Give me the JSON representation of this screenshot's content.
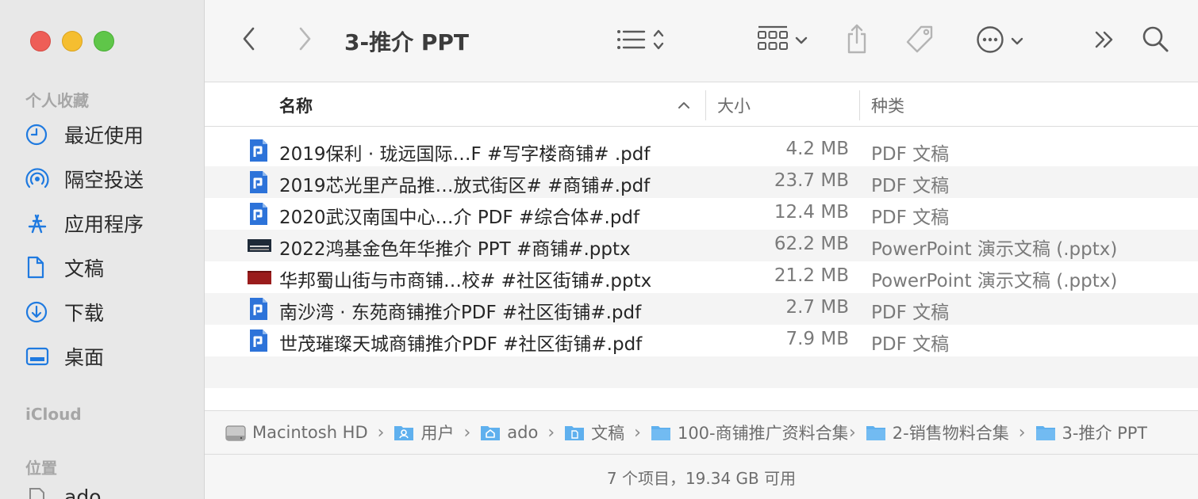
{
  "window": {
    "title": "3-推介 PPT"
  },
  "sidebar": {
    "favorites_label": "个人收藏",
    "items": [
      {
        "label": "最近使用",
        "icon": "clock-icon"
      },
      {
        "label": "隔空投送",
        "icon": "airdrop-icon"
      },
      {
        "label": "应用程序",
        "icon": "applications-icon"
      },
      {
        "label": "文稿",
        "icon": "document-icon"
      },
      {
        "label": "下载",
        "icon": "download-icon"
      },
      {
        "label": "桌面",
        "icon": "desktop-icon"
      }
    ],
    "icloud_label": "iCloud",
    "locations_label": "位置",
    "partial_item_label": "ado"
  },
  "columns": {
    "name": "名称",
    "size": "大小",
    "kind": "种类"
  },
  "files": [
    {
      "name": "2019保利 · 珑远国际…F #写字楼商铺# .pdf",
      "size": "4.2 MB",
      "kind": "PDF 文稿",
      "icon": "pdf-file-icon"
    },
    {
      "name": "2019芯光里产品推…放式街区# #商铺#.pdf",
      "size": "23.7 MB",
      "kind": "PDF 文稿",
      "icon": "pdf-file-icon"
    },
    {
      "name": "2020武汉南国中心…介 PDF #综合体#.pdf",
      "size": "12.4 MB",
      "kind": "PDF 文稿",
      "icon": "pdf-file-icon"
    },
    {
      "name": "2022鸿基金色年华推介 PPT #商铺#.pptx",
      "size": "62.2 MB",
      "kind": "PowerPoint 演示文稿 (.pptx)",
      "icon": "pptx-thumbnail-dark-icon"
    },
    {
      "name": "华邦蜀山街与市商铺…校# #社区街铺#.pptx",
      "size": "21.2 MB",
      "kind": "PowerPoint 演示文稿 (.pptx)",
      "icon": "pptx-thumbnail-red-icon"
    },
    {
      "name": "南沙湾 · 东苑商铺推介PDF #社区街铺#.pdf",
      "size": "2.7 MB",
      "kind": "PDF 文稿",
      "icon": "pdf-file-icon"
    },
    {
      "name": "世茂璀璨天城商铺推介PDF #社区街铺#.pdf",
      "size": "7.9 MB",
      "kind": "PDF 文稿",
      "icon": "pdf-file-icon"
    }
  ],
  "path": [
    {
      "label": "Macintosh HD",
      "icon": "hard-drive-icon"
    },
    {
      "label": "用户",
      "icon": "users-folder-icon"
    },
    {
      "label": "ado",
      "icon": "home-folder-icon"
    },
    {
      "label": "文稿",
      "icon": "documents-folder-icon"
    },
    {
      "label": "100-商铺推广资料合集",
      "icon": "folder-icon"
    },
    {
      "label": "2-销售物料合集",
      "icon": "folder-icon"
    },
    {
      "label": "3-推介 PPT",
      "icon": "folder-icon"
    }
  ],
  "status": {
    "text": "7 个项目，19.34 GB 可用"
  },
  "colors": {
    "accent": "#1f7ae0",
    "folder": "#4aa3e8",
    "pdf": "#2d73d9"
  }
}
